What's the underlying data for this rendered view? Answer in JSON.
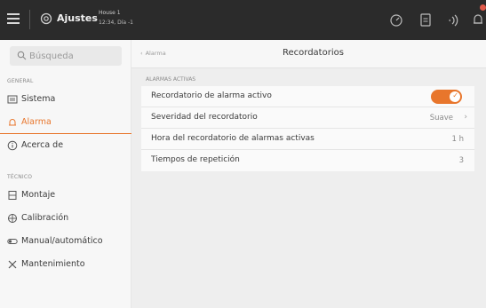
{
  "topbar": {
    "app_title": "Ajustes",
    "context_line1": "House 1",
    "context_line2": "12:34, Día -1",
    "icons": [
      "menu-icon",
      "gear-icon",
      "dashboard-icon",
      "clipboard-icon",
      "signal-icon",
      "bell-icon"
    ],
    "accent": "#e8762c"
  },
  "sidebar": {
    "search_placeholder": "Búsqueda",
    "section_general": "GENERAL",
    "general_items": [
      {
        "label": "Sistema",
        "icon": "system-icon"
      },
      {
        "label": "Alarma",
        "icon": "alarm-icon",
        "active": true
      },
      {
        "label": "Acerca de",
        "icon": "info-icon"
      }
    ],
    "section_tecnico": "TÉCNICO",
    "tecnico_items": [
      {
        "label": "Montaje",
        "icon": "mount-icon"
      },
      {
        "label": "Calibración",
        "icon": "calibration-icon"
      },
      {
        "label": "Manual/automático",
        "icon": "toggle-icon"
      },
      {
        "label": "Mantenimiento",
        "icon": "tools-icon"
      }
    ]
  },
  "main": {
    "back_label": "Alarma",
    "title": "Recordatorios",
    "group_label": "ALARMAS ACTIVAS",
    "rows": [
      {
        "label": "Recordatorio de alarma activo",
        "toggle_on": true
      },
      {
        "label": "Severidad del recordatorio",
        "value": "Suave"
      },
      {
        "label": "Hora del recordatorio de alarmas activas",
        "value": "1 h"
      },
      {
        "label": "Tiempos de repetición",
        "value": "3"
      }
    ]
  }
}
